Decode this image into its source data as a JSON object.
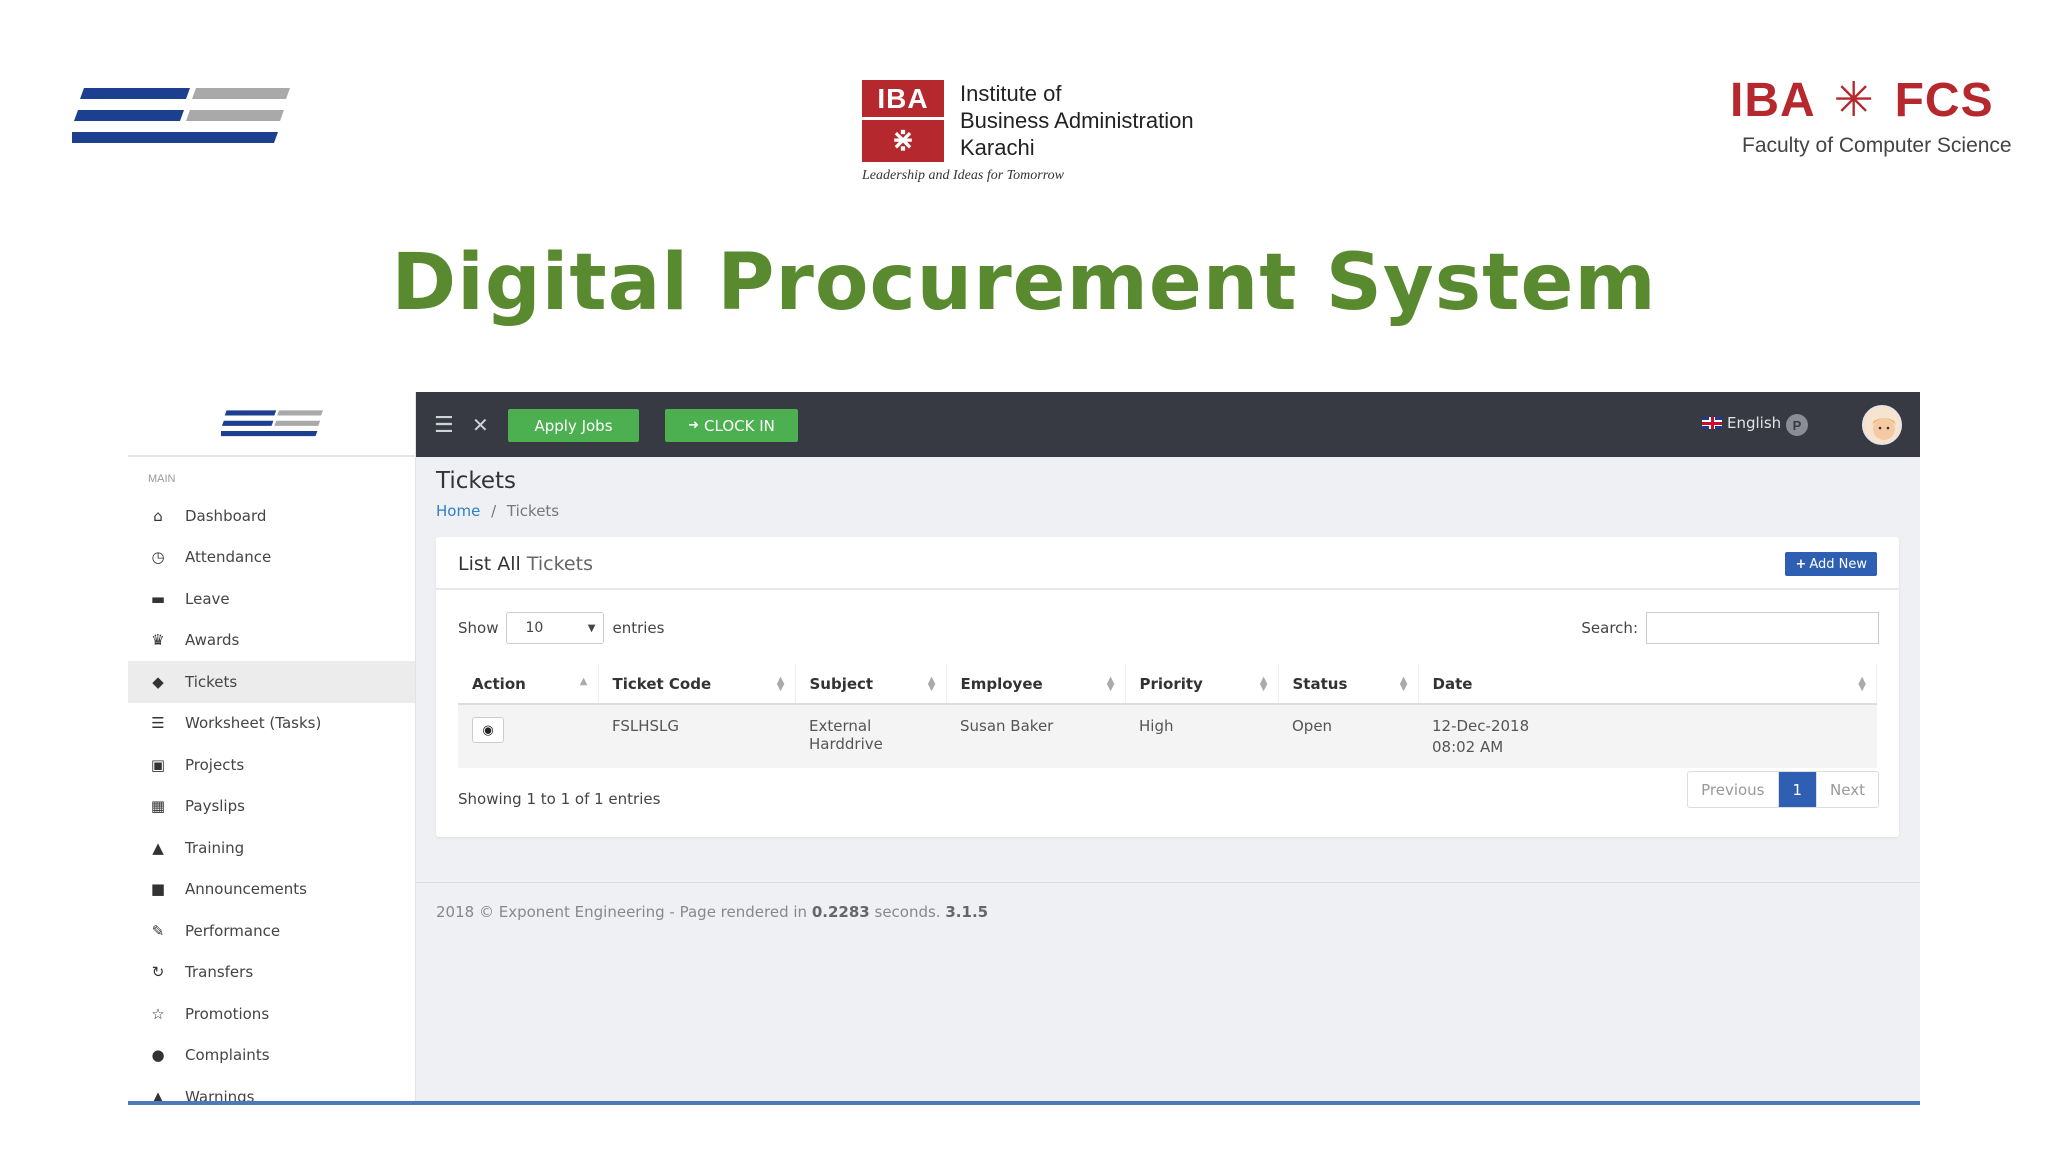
{
  "header": {
    "iba": {
      "badge_top": "IBA",
      "badge_bottom": "⋇",
      "lines": [
        "Institute of",
        "Business Administration",
        "Karachi"
      ],
      "tagline": "Leadership and Ideas for Tomorrow"
    },
    "fcs": {
      "left": "IBA",
      "right": "FCS",
      "subtitle": "Faculty of Computer Science"
    },
    "title": "Digital Procurement System"
  },
  "app": {
    "sidebar": {
      "section": "MAIN",
      "items": [
        {
          "label": "Dashboard",
          "icon": "home-icon",
          "glyph": "⌂"
        },
        {
          "label": "Attendance",
          "icon": "clock-icon",
          "glyph": "◷"
        },
        {
          "label": "Leave",
          "icon": "bed-icon",
          "glyph": "▬"
        },
        {
          "label": "Awards",
          "icon": "trophy-icon",
          "glyph": "♛"
        },
        {
          "label": "Tickets",
          "icon": "ticket-icon",
          "glyph": "◆"
        },
        {
          "label": "Worksheet (Tasks)",
          "icon": "list-icon",
          "glyph": "☰"
        },
        {
          "label": "Projects",
          "icon": "archive-icon",
          "glyph": "▣"
        },
        {
          "label": "Payslips",
          "icon": "calculator-icon",
          "glyph": "▦"
        },
        {
          "label": "Training",
          "icon": "graduation-cap-icon",
          "glyph": "▲"
        },
        {
          "label": "Announcements",
          "icon": "sticky-note-icon",
          "glyph": "■"
        },
        {
          "label": "Performance",
          "icon": "edit-icon",
          "glyph": "✎"
        },
        {
          "label": "Transfers",
          "icon": "refresh-icon",
          "glyph": "↻"
        },
        {
          "label": "Promotions",
          "icon": "star-icon",
          "glyph": "☆"
        },
        {
          "label": "Complaints",
          "icon": "exclamation-circle-icon",
          "glyph": "●"
        },
        {
          "label": "Warnings",
          "icon": "warning-icon",
          "glyph": "▲"
        }
      ],
      "active_index": 4
    },
    "topbar": {
      "apply_jobs": "Apply Jobs",
      "clock_in": "CLOCK IN",
      "language": "English",
      "profile_badge": "P"
    },
    "page": {
      "title": "Tickets",
      "breadcrumb_home": "Home",
      "breadcrumb_sep": "/",
      "breadcrumb_current": "Tickets"
    },
    "card": {
      "title_prefix": "List All",
      "title_suffix": "Tickets",
      "add_new": "Add New",
      "show_label": "Show",
      "entries_value": "10",
      "entries_label": "entries",
      "search_label": "Search:",
      "columns": [
        "Action",
        "Ticket Code",
        "Subject",
        "Employee",
        "Priority",
        "Status",
        "Date"
      ],
      "rows": [
        {
          "ticket_code": "FSLHSLG",
          "subject": "External Harddrive",
          "employee": "Susan Baker",
          "priority": "High",
          "status": "Open",
          "date_line1": "12-Dec-2018",
          "date_line2": "08:02 AM"
        }
      ],
      "showing": "Showing 1 to 1 of 1 entries",
      "pager": {
        "previous": "Previous",
        "current": "1",
        "next": "Next"
      }
    },
    "footer": {
      "text": "2018 © Exponent Engineering - Page rendered in",
      "seconds": "0.2283",
      "seconds_label": "seconds.",
      "version": "3.1.5"
    }
  },
  "colors": {
    "title_green": "#5a8a2f",
    "iba_red": "#b5282d",
    "navy": "#1d3f8f",
    "topbar": "#373a43",
    "button_green": "#4caf50",
    "primary_blue": "#2f5fb3"
  }
}
